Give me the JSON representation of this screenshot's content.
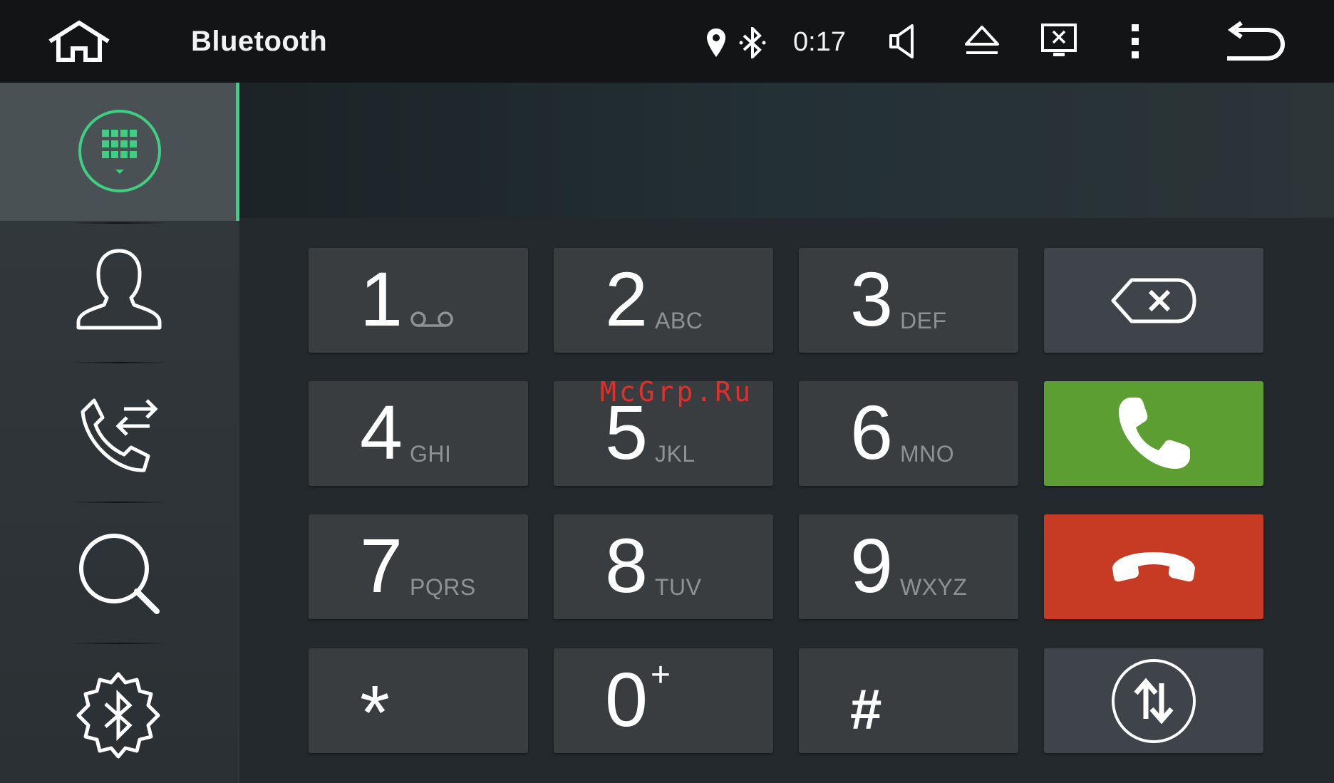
{
  "header": {
    "app_title": "Bluetooth",
    "clock": "0:17",
    "icons": [
      "home-icon",
      "location-icon",
      "bluetooth-status-icon",
      "volume-icon",
      "eject-icon",
      "screen-off-icon",
      "more-vert-icon",
      "back-icon"
    ]
  },
  "sidebar": {
    "items": [
      {
        "name": "dialpad",
        "icon": "dialpad-icon",
        "active": true
      },
      {
        "name": "contacts",
        "icon": "contacts-icon",
        "active": false
      },
      {
        "name": "call-log",
        "icon": "call-log-icon",
        "active": false
      },
      {
        "name": "search",
        "icon": "search-icon",
        "active": false
      },
      {
        "name": "bluetooth-settings",
        "icon": "bluetooth-settings-icon",
        "active": false
      }
    ],
    "accent_color": "#3ecf82"
  },
  "display": {
    "number": ""
  },
  "keypad": {
    "keys": [
      {
        "digit": "1",
        "letters": ""
      },
      {
        "digit": "2",
        "letters": "ABC"
      },
      {
        "digit": "3",
        "letters": "DEF"
      },
      {
        "digit": "4",
        "letters": "GHI"
      },
      {
        "digit": "5",
        "letters": "JKL"
      },
      {
        "digit": "6",
        "letters": "MNO"
      },
      {
        "digit": "7",
        "letters": "PQRS"
      },
      {
        "digit": "8",
        "letters": "TUV"
      },
      {
        "digit": "9",
        "letters": "WXYZ"
      },
      {
        "digit": "*",
        "letters": ""
      },
      {
        "digit": "0",
        "letters": "+"
      },
      {
        "digit": "#",
        "letters": ""
      }
    ],
    "actions": {
      "backspace_icon": "backspace-icon",
      "call_icon": "call-icon",
      "hangup_icon": "hangup-icon",
      "transfer_icon": "swap-audio-icon"
    },
    "colors": {
      "key_bg": "#3a3d3f",
      "call": "#5d9e32",
      "hangup": "#c73a24"
    }
  },
  "watermark": "McGrp.Ru"
}
